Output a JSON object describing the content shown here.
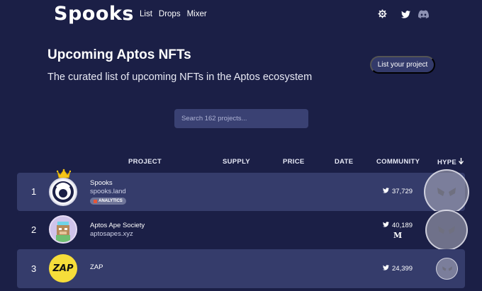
{
  "header": {
    "logo": "Spooks",
    "nav": [
      "List",
      "Drops",
      "Mixer"
    ],
    "icons": [
      "settings-icon",
      "twitter-icon",
      "discord-icon"
    ]
  },
  "hero": {
    "title": "Upcoming Aptos NFTs",
    "subtitle": "The curated list of upcoming NFTs in the Aptos ecosystem",
    "cta": "List your project"
  },
  "search": {
    "placeholder": "Search 162 projects..."
  },
  "table": {
    "headers": {
      "project": "PROJECT",
      "supply": "SUPPLY",
      "price": "PRICE",
      "date": "DATE",
      "community": "COMMUNITY",
      "hype": "HYPE"
    },
    "rows": [
      {
        "rank": "1",
        "name": "Spooks",
        "url": "spooks.land",
        "badge": "ANALYTICS",
        "twitter": "37,729",
        "has_medium": false
      },
      {
        "rank": "2",
        "name": "Aptos Ape Society",
        "url": "aptosapes.xyz",
        "badge": "",
        "twitter": "40,189",
        "has_medium": true,
        "medium_label": "M"
      },
      {
        "rank": "3",
        "name": "ZAP",
        "url": "",
        "badge": "",
        "twitter": "24,399",
        "has_medium": false,
        "avatar_text": "ZAP"
      }
    ]
  },
  "colors": {
    "background": "#1b1f46",
    "row_highlight": "#353c6b",
    "button": "#333a6a"
  }
}
